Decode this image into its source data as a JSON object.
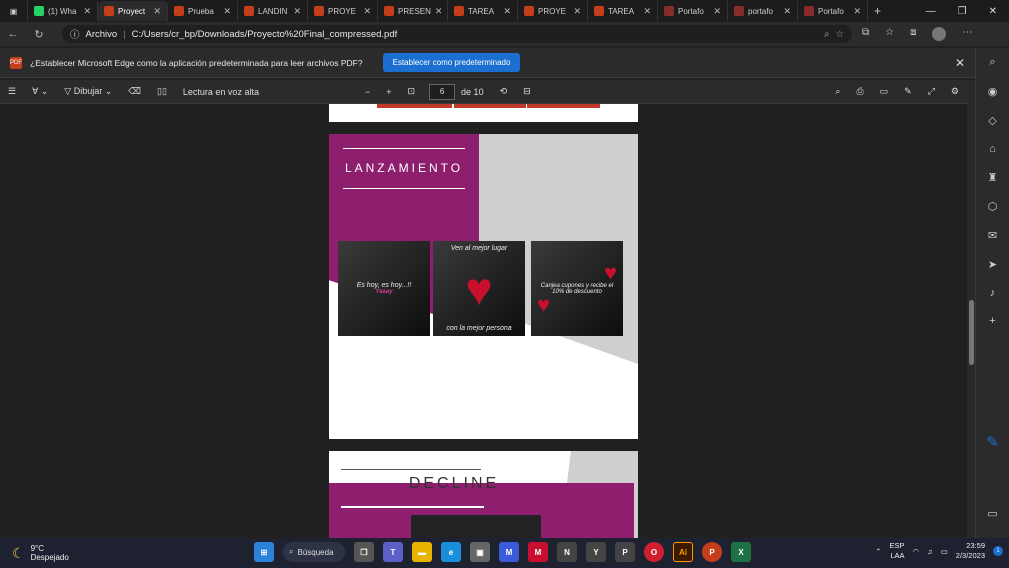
{
  "tabs": [
    {
      "label": "(1) Wha",
      "color": "#25d366",
      "icon": "whatsapp-icon"
    },
    {
      "label": "Proyect",
      "color": "#c43e1c",
      "icon": "pdf-icon"
    },
    {
      "label": "Prueba",
      "color": "#c43e1c",
      "icon": "pdf-icon"
    },
    {
      "label": "LANDIN",
      "color": "#c43e1c",
      "icon": "pdf-icon"
    },
    {
      "label": "PROYE",
      "color": "#c43e1c",
      "icon": "pdf-icon"
    },
    {
      "label": "PRESEN",
      "color": "#c43e1c",
      "icon": "pdf-icon"
    },
    {
      "label": "TAREA",
      "color": "#c43e1c",
      "icon": "pdf-icon"
    },
    {
      "label": "PROYE",
      "color": "#c43e1c",
      "icon": "pdf-icon"
    },
    {
      "label": "TAREA",
      "color": "#c43e1c",
      "icon": "pdf-icon"
    },
    {
      "label": "Portafo",
      "color": "#8a2b2b",
      "icon": "shield-icon"
    },
    {
      "label": "portafo",
      "color": "#8a2b2b",
      "icon": "shield-icon"
    },
    {
      "label": "Portafo",
      "color": "#8a2b2b",
      "icon": "shield-icon"
    }
  ],
  "address": {
    "label": "Archivo",
    "url": "C:/Users/cr_bp/Downloads/Proyecto%20Final_compressed.pdf"
  },
  "infobar": {
    "message": "¿Establecer Microsoft Edge como la aplicación predeterminada para leer archivos PDF?",
    "button": "Establecer como predeterminado",
    "badge": "PDF"
  },
  "pdf_toolbar": {
    "draw": "Dibujar",
    "read_aloud": "Lectura en voz alta",
    "page": "6",
    "of_pages": "de 10"
  },
  "page6": {
    "title": "LANZAMIENTO",
    "cards": [
      "Es hoy, es hoy...!!",
      "Ven al mejor lugar",
      "con la mejor persona",
      "Canjea cupones y recibe el 10% de descuento"
    ],
    "card_brand": "Yaaay"
  },
  "page7": {
    "title": "DECLINE"
  },
  "taskbar": {
    "weather_temp": "9°C",
    "weather_desc": "Despejado",
    "search": "Búsqueda",
    "lang1": "ESP",
    "lang2": "LAA",
    "time": "23:59",
    "date": "2/3/2023",
    "notif": "1"
  },
  "colors": {
    "accent": "#1b6fd0",
    "magenta": "#8e1f6f",
    "pdf_red": "#c43e1c"
  }
}
